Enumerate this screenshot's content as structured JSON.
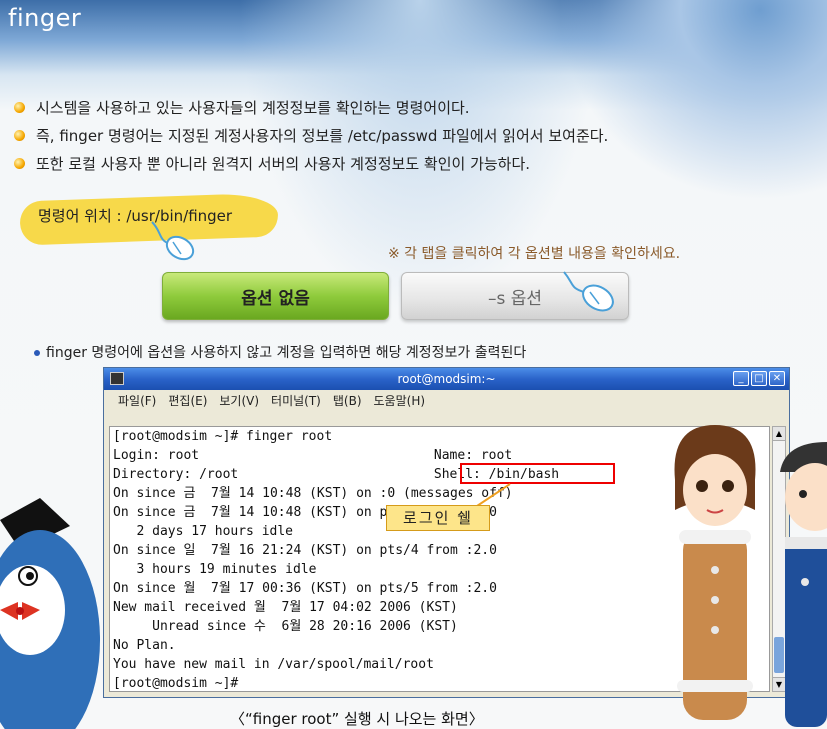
{
  "header": {
    "title": "finger"
  },
  "bullets": [
    "시스템을 사용하고 있는 사용자들의 계정정보를 확인하는 명령어이다.",
    "즉, finger 명령어는 지정된 계정사용자의 정보를 /etc/passwd 파일에서 읽어서 보여준다.",
    "또한 로컬 사용자 뿐 아니라 원격지 서버의 사용자 계정정보도 확인이 가능하다."
  ],
  "command_path": {
    "label": "명령어 위치 : /usr/bin/finger"
  },
  "hint": "※ 각 탭을 클릭하여 각 옵션별 내용을 확인하세요.",
  "tabs": [
    {
      "label": "옵션 없음",
      "active": true
    },
    {
      "label": "–s 옵션",
      "active": false
    }
  ],
  "description": "finger 명령어에 옵션을 사용하지 않고 계정을 입력하면 해당 계정정보가 출력된다",
  "terminal": {
    "window_title": "root@modsim:~",
    "menu": [
      "파일(F)",
      "편집(E)",
      "보기(V)",
      "터미널(T)",
      "탭(B)",
      "도움말(H)"
    ],
    "lines": [
      "[root@modsim ~]# finger root",
      "Login: root                              Name: root",
      "Directory: /root                         Shell: /bin/bash",
      "On since 금  7월 14 10:48 (KST) on :0 (messages off)",
      "On since 금  7월 14 10:48 (KST) on pts/1 from :0.0",
      "   2 days 17 hours idle",
      "On since 일  7월 16 21:24 (KST) on pts/4 from :2.0",
      "   3 hours 19 minutes idle",
      "On since 월  7월 17 00:36 (KST) on pts/5 from :2.0",
      "New mail received 월  7월 17 04:02 2006 (KST)",
      "     Unread since 수  6월 28 20:16 2006 (KST)",
      "No Plan.",
      "You have new mail in /var/spool/mail/root",
      "[root@modsim ~]#"
    ]
  },
  "annotation": {
    "label": "로그인 쉘"
  },
  "caption": "〈“finger root” 실행 시 나오는 화면〉",
  "colors": {
    "active_tab": "#8fcb3c",
    "highlight": "#ee0000",
    "callout": "#fde58a",
    "title_bar": "#2a63c9"
  }
}
